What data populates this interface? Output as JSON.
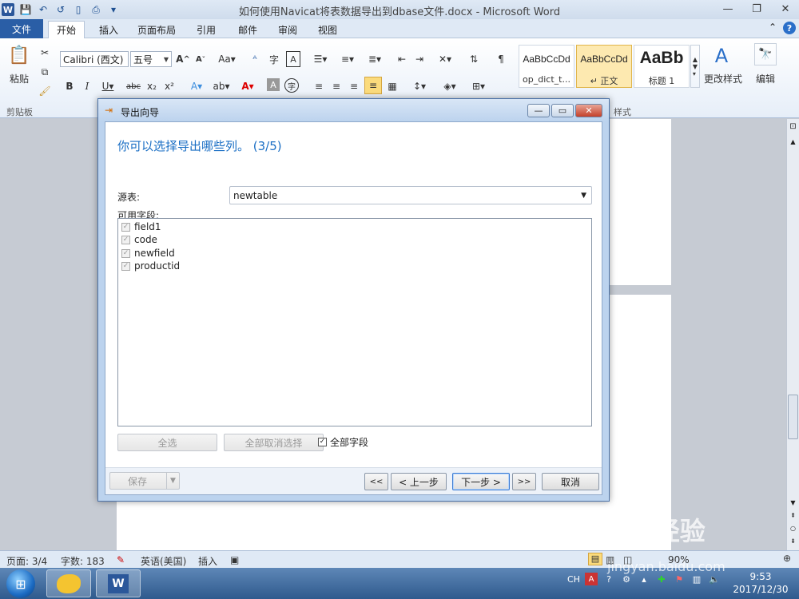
{
  "window": {
    "title": "如何使用Navicat将表数据导出到dbase文件.docx - Microsoft Word",
    "app_icon": "W"
  },
  "ribbon": {
    "tabs": [
      "文件",
      "开始",
      "插入",
      "页面布局",
      "引用",
      "邮件",
      "审阅",
      "视图"
    ],
    "active_tab": "开始",
    "paste_label": "粘贴",
    "clipboard_label": "剪贴板",
    "font_name": "Calibri (西文)",
    "font_size": "五号",
    "styles_label": "样式",
    "styles": [
      {
        "sample": "AaBbCcDd",
        "name": "op_dict_t..."
      },
      {
        "sample": "AaBbCcDd",
        "name": "↵ 正文"
      },
      {
        "sample": "AaBb",
        "name": "标题 1"
      }
    ],
    "change_styles_label": "更改样式",
    "edit_label": "编辑"
  },
  "dialog": {
    "title": "导出向导",
    "heading": "你可以选择导出哪些列。 (3/5)",
    "source_label": "源表:",
    "source_value": "newtable",
    "fields_label": "可用字段:",
    "fields": [
      "field1",
      "code",
      "newfield",
      "productid"
    ],
    "select_all": "全选",
    "deselect_all": "全部取消选择",
    "all_fields_label": "全部字段",
    "all_fields_checked": true,
    "save": "保存",
    "first": "<<",
    "prev": "< 上一步",
    "next": "下一步 >",
    "last": ">>",
    "cancel": "取消"
  },
  "statusbar": {
    "page": "页面: 3/4",
    "words": "字数: 183",
    "language": "英语(美国)",
    "mode": "插入",
    "zoom": "90%"
  },
  "taskbar": {
    "ime": "CH",
    "time": "9:53",
    "date": "2017/12/30"
  },
  "watermark": {
    "brand": "Bai 经验",
    "url": "jingyan.baidu.com"
  }
}
